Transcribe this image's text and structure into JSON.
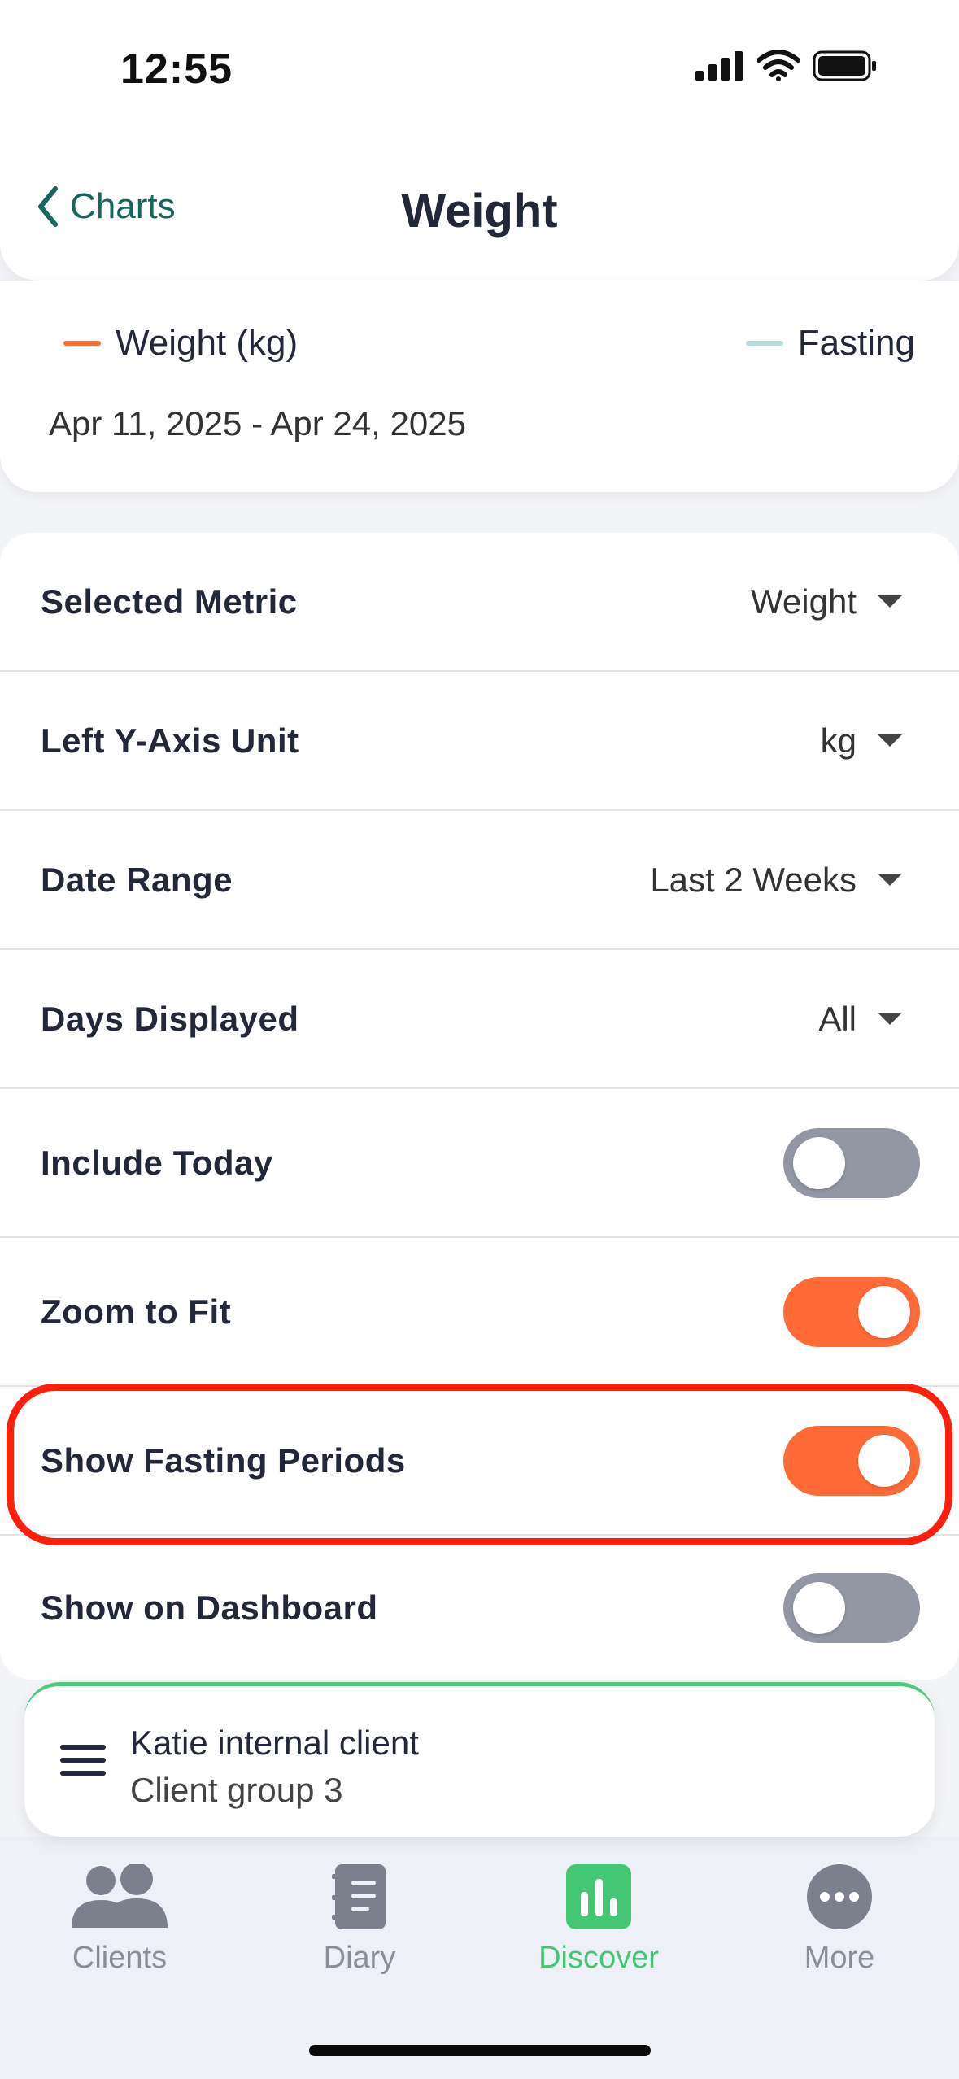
{
  "status_bar": {
    "time": "12:55"
  },
  "header": {
    "back_label": "Charts",
    "title": "Weight"
  },
  "legend": {
    "items": [
      {
        "label": "Weight (kg)",
        "color": "#ff6a37"
      },
      {
        "label": "Fasting",
        "color": "#b9dcdc"
      }
    ],
    "date_range": "Apr 11, 2025 - Apr 24, 2025"
  },
  "settings": {
    "selected_metric": {
      "label": "Selected Metric",
      "value": "Weight"
    },
    "left_y_axis_unit": {
      "label": "Left Y-Axis Unit",
      "value": "kg"
    },
    "date_range": {
      "label": "Date Range",
      "value": "Last 2 Weeks"
    },
    "days_displayed": {
      "label": "Days Displayed",
      "value": "All"
    },
    "include_today": {
      "label": "Include Today",
      "on": false
    },
    "zoom_to_fit": {
      "label": "Zoom to Fit",
      "on": true
    },
    "show_fasting_periods": {
      "label": "Show Fasting Periods",
      "on": true
    },
    "show_on_dashboard": {
      "label": "Show on Dashboard",
      "on": false
    }
  },
  "client_bar": {
    "name": "Katie internal client",
    "group": "Client group 3"
  },
  "nav": {
    "items": [
      {
        "label": "Clients",
        "icon": "people-icon",
        "active": false
      },
      {
        "label": "Diary",
        "icon": "notebook-icon",
        "active": false
      },
      {
        "label": "Discover",
        "icon": "bar-chart-icon",
        "active": true
      },
      {
        "label": "More",
        "icon": "more-dots-icon",
        "active": false
      }
    ]
  },
  "colors": {
    "accent_orange": "#ff6a37",
    "toggle_off": "#9397a3",
    "highlight_red": "#ff1f0a",
    "active_green": "#44c775",
    "link_teal": "#17665e"
  }
}
